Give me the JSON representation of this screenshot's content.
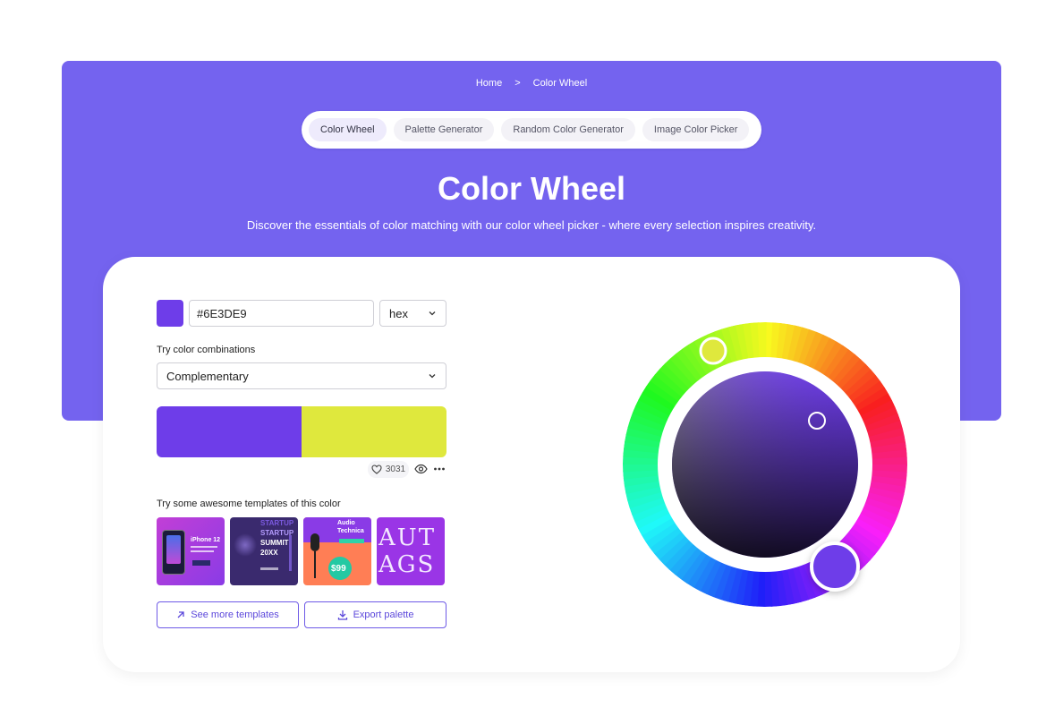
{
  "breadcrumb": {
    "home": "Home",
    "separator": ">",
    "current": "Color Wheel"
  },
  "tabs": [
    {
      "label": "Color Wheel",
      "active": true
    },
    {
      "label": "Palette Generator",
      "active": false
    },
    {
      "label": "Random Color Generator",
      "active": false
    },
    {
      "label": "Image Color Picker",
      "active": false
    }
  ],
  "hero": {
    "title": "Color Wheel",
    "subtitle": "Discover the essentials of color matching with our color wheel picker - where every selection inspires creativity."
  },
  "picker": {
    "hex_value": "#6E3DE9",
    "format": "hex",
    "combo_label": "Try color combinations",
    "combo_value": "Complementary",
    "selected_color": "#6e3de9"
  },
  "palette": {
    "colors": [
      "#6e3de9",
      "#dfe83d"
    ],
    "likes": "3031"
  },
  "templates": {
    "label": "Try some awesome templates of this color",
    "items": [
      {
        "text": [
          "iPhone 12"
        ]
      },
      {
        "text": [
          "STARTUP",
          "STARTUP",
          "SUMMIT",
          "20XX"
        ]
      },
      {
        "text": [
          "Audio",
          "Technica",
          "$99"
        ]
      },
      {
        "text": [
          "AUTAGS"
        ]
      }
    ]
  },
  "actions": {
    "see_more": "See more templates",
    "export": "Export palette"
  },
  "colors": {
    "brand": "#7463ef",
    "accent_text": "#5b47db"
  }
}
